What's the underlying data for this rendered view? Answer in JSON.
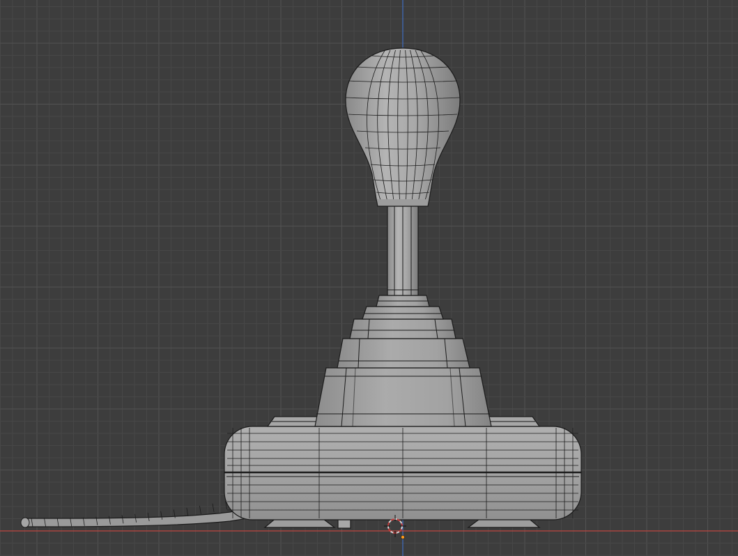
{
  "viewport": {
    "background": "#3d3d3d",
    "grid_minor_color": "#474747",
    "grid_major_color": "#525252",
    "axis_x_color": "#c0463f",
    "axis_z_color": "#3f6ec0",
    "wire_color": "#1b1b1b"
  },
  "scene": {
    "object": "joystick-model",
    "shading": "solid-with-wireframe",
    "view": "front-orthographic"
  },
  "icons": {
    "cursor": "3d-cursor-icon",
    "origin": "object-origin-icon"
  }
}
